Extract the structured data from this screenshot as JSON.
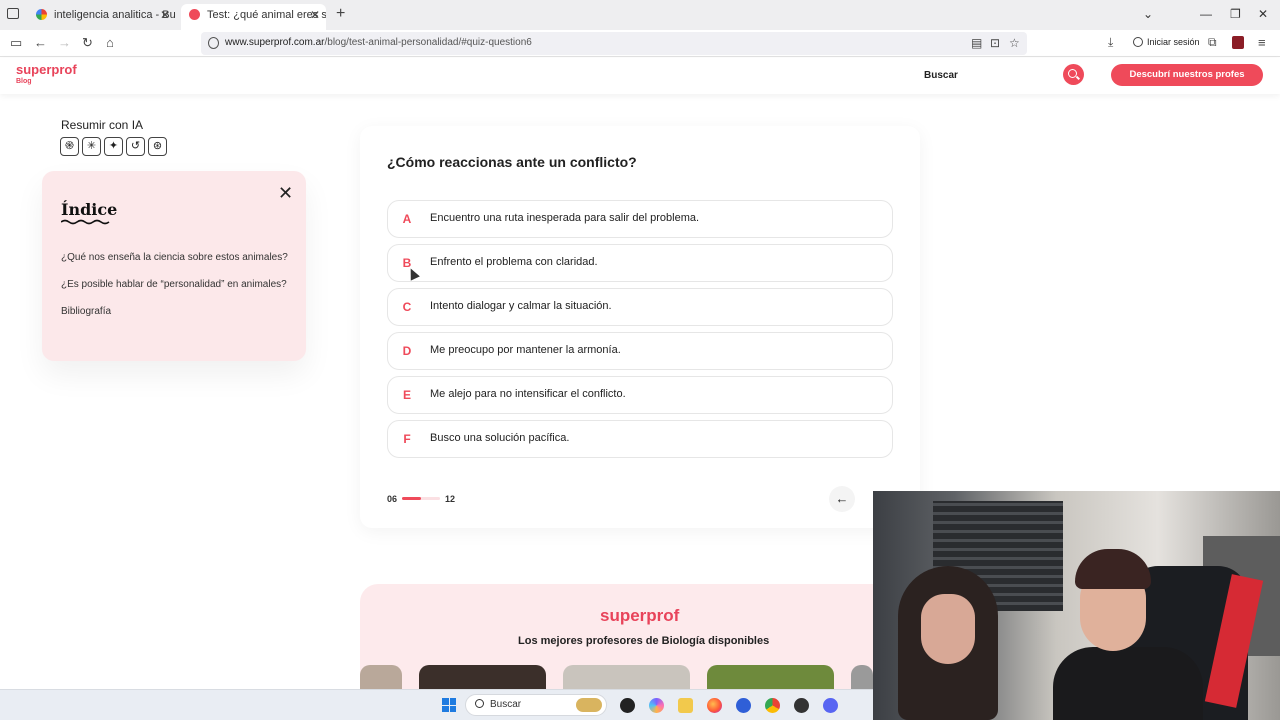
{
  "browser": {
    "tabs": [
      {
        "title": "inteligencia analitica - Buscar co",
        "active": false
      },
      {
        "title": "Test: ¿qué animal eres según tu",
        "active": true
      }
    ],
    "url_domain": "www.superprof.com.ar",
    "url_path": "/blog/test-animal-personalidad/#quiz-question6",
    "signin_label": "Iniciar sesión"
  },
  "header": {
    "logo": "superprof",
    "logo_sub": "Blog",
    "search_label": "Buscar",
    "cta": "Descubrí nuestros profes"
  },
  "sidebar": {
    "resumir": "Resumir con IA",
    "ai_icons": [
      "chatgpt-icon",
      "claude-icon",
      "gemini-icon",
      "perplexity-icon",
      "grok-icon"
    ],
    "ai_glyphs": [
      "֎",
      "✳",
      "✦",
      "↺",
      "⊛"
    ],
    "indice_title": "Índice",
    "indice_items": [
      "¿Qué nos enseña la ciencia sobre estos animales?",
      "¿Es posible hablar de “personalidad” en animales?",
      "Bibliografía"
    ]
  },
  "quiz": {
    "question": "¿Cómo reaccionas ante un conflicto?",
    "options": [
      {
        "letter": "A",
        "text": "Encuentro una ruta inesperada para salir del problema."
      },
      {
        "letter": "B",
        "text": "Enfrento el problema con claridad."
      },
      {
        "letter": "C",
        "text": "Intento dialogar y calmar la situación."
      },
      {
        "letter": "D",
        "text": "Me preocupo por mantener la armonía."
      },
      {
        "letter": "E",
        "text": "Me alejo para no intensificar el conflicto."
      },
      {
        "letter": "F",
        "text": "Busco una solución pacífica."
      }
    ],
    "progress_current": "06",
    "progress_total": "12",
    "progress_fraction": 0.5
  },
  "promo": {
    "logo": "superprof",
    "title": "Los mejores profesores de Biología disponibles"
  },
  "taskbar": {
    "search_label": "Buscar"
  },
  "colors": {
    "brand": "#e8435a",
    "accent": "#ef4a5a",
    "panel_pink": "#fce8ea"
  }
}
